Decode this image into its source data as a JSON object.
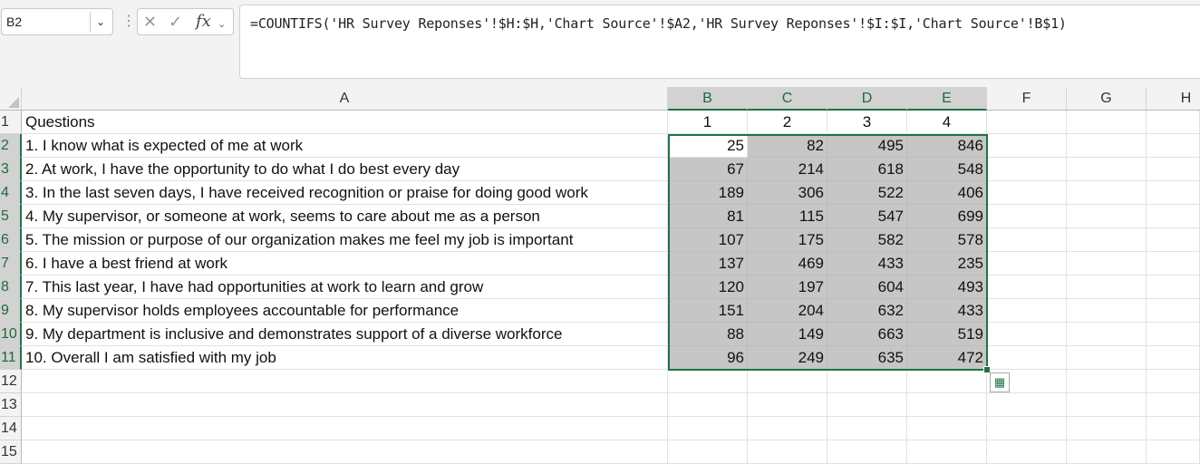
{
  "formula_bar": {
    "name_box": "B2",
    "formula": "=COUNTIFS('HR Survey Reponses'!$H:$H,'Chart Source'!$A2,'HR Survey Reponses'!$I:$I,'Chart Source'!B$1)",
    "icons": [
      "chevron-down-icon",
      "more-vertical-icon",
      "cancel-icon",
      "enter-icon",
      "insert-function-icon"
    ]
  },
  "columns": [
    "A",
    "B",
    "C",
    "D",
    "E",
    "F",
    "G",
    "H"
  ],
  "rows": [
    "1",
    "2",
    "3",
    "4",
    "5",
    "6",
    "7",
    "8",
    "9",
    "10",
    "11",
    "12",
    "13",
    "14",
    "15"
  ],
  "header_row": {
    "A": "Questions",
    "B": "1",
    "C": "2",
    "D": "3",
    "E": "4"
  },
  "data_rows": [
    {
      "question": "1. I know what is expected of me at work",
      "values": [
        "25",
        "82",
        "495",
        "846"
      ]
    },
    {
      "question": "2. At work, I have the opportunity to do what I do best every day",
      "values": [
        "67",
        "214",
        "618",
        "548"
      ]
    },
    {
      "question": "3. In the last seven days, I have received recognition or praise for doing good work",
      "values": [
        "189",
        "306",
        "522",
        "406"
      ]
    },
    {
      "question": "4. My supervisor, or someone at work, seems to care about me as a person",
      "values": [
        "81",
        "115",
        "547",
        "699"
      ]
    },
    {
      "question": "5. The mission or purpose of our organization makes me feel my job is important",
      "values": [
        "107",
        "175",
        "582",
        "578"
      ]
    },
    {
      "question": "6. I have a best friend at work",
      "values": [
        "137",
        "469",
        "433",
        "235"
      ]
    },
    {
      "question": "7. This last year, I have had opportunities at work to learn and grow",
      "values": [
        "120",
        "197",
        "604",
        "493"
      ]
    },
    {
      "question": "8. My supervisor holds employees accountable for performance",
      "values": [
        "151",
        "204",
        "632",
        "433"
      ]
    },
    {
      "question": "9. My department is inclusive and demonstrates support of a diverse workforce",
      "values": [
        "88",
        "149",
        "663",
        "519"
      ]
    },
    {
      "question": "10. Overall I am satisfied with my job",
      "values": [
        "96",
        "249",
        "635",
        "472"
      ]
    }
  ],
  "colors": {
    "accent": "#217346",
    "selection_fill": "#c6c6c6"
  }
}
